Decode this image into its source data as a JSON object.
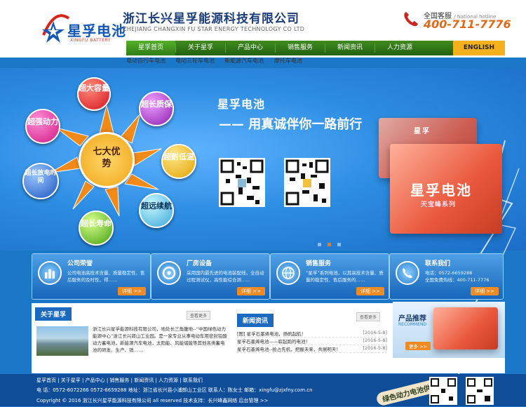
{
  "header": {
    "logo_text": "星孚电池",
    "logo_sub": "XINGFU BATTERY",
    "company_name": "浙江长兴星孚能源科技有限公司",
    "company_name_en": "ZHEJIANG CHANGXIN FU STAR ENERGY TECHNOLOGY CO LTD",
    "hotline_label": "全国客服",
    "hotline_label_en": "/ National hotline",
    "hotline_number": "400-711-7776"
  },
  "nav": {
    "items": [
      "星孚首页",
      "关于星孚",
      "产品中心",
      "销售服务",
      "新闻资讯",
      "人力资源"
    ],
    "english": "ENGLISH",
    "sub_items": [
      "电动自行车电池",
      "电动三轮车电池",
      "新能源汽车电池",
      "摩托车电池"
    ]
  },
  "banner": {
    "hub": "七大优势",
    "features": [
      "超大容量",
      "超长质保",
      "超耐低温",
      "超远续航",
      "超长寿命",
      "超长放电时间",
      "超强动力"
    ],
    "slogan_title": "星孚电池",
    "slogan_line": "—— 用真诚伴你一路前行",
    "battery_brand": "星孚电池",
    "battery_series": "天宝峰系列",
    "battery_top": "星孚",
    "slide_count": 3,
    "active_slide": 1
  },
  "features": [
    {
      "title": "公司荣誉",
      "desc": "公司电池高技术含量、质量稳定性、售后服务的及时性，得……",
      "more": "详细 >>"
    },
    {
      "title": "厂房设备",
      "desc": "采用国内最先进的电池装配线，全自动过程测试仪，高性能综合测……",
      "more": "详细 >>"
    },
    {
      "title": "销售服务",
      "desc": "“星孚”系列电池，以其高技术含量、质量的稳定性、售后服务的……",
      "more": "详细 >>"
    },
    {
      "title": "联系我们",
      "desc": "电话：0572-6659288\n全国免费热线：400-711-7776",
      "more": "详细 >>"
    }
  ],
  "about": {
    "title": "关于星孚",
    "more": "查看更多",
    "text": "浙江长兴星孚能源科技有限公司，地处长三角腹地--“中国绿色动力能源中心”浙江长兴郎山工业园。是一家专业从事电动车用密封铅酸动力蓄电池，新能源汽车电池，太阳能、风能储能等其他各类蓄电池的研发、生产、销……"
  },
  "news": {
    "title": "新闻资讯",
    "more": "查看更多",
    "items": [
      {
        "text": "[图] 星孚石墨烯电池，扬帆起航！",
        "date": "[2016-5-8]"
      },
      {
        "text": "星孚石墨烯电池——崭起跑的电池！",
        "date": "[2016-5-8]"
      },
      {
        "text": "星孚石墨烯电池--抢占先机，把握未来，共展明天！",
        "date": "[2016-5-8]"
      }
    ]
  },
  "recommend": {
    "title": "产品推荐",
    "title_en": "RECOMMEND",
    "more": "更多 >>"
  },
  "footer": {
    "links": "星孚首页 | 关于星孚 | 产品中心 | 销售服务 | 新闻资讯 | 人力资源 | 联系我们",
    "contact": "电 话：0572-6072266 0572-6659288 地址：浙江省长兴县小浦郎山工业区 联系人：陈女士 邮箱：xingfu@zjxfny.com.cn",
    "copyright": "Copyright © 2016 浙江长兴星孚能源科技有限公司 all reserved 技术支持：长兴峰鑫网络 后台管理 >>",
    "slogan": "绿色动力电池供应商"
  },
  "colors": {
    "nav_green": "#3f8b1f",
    "accent_orange": "#f08a24",
    "brand_blue": "#1457b5",
    "english_yellow": "#f4b11c"
  }
}
